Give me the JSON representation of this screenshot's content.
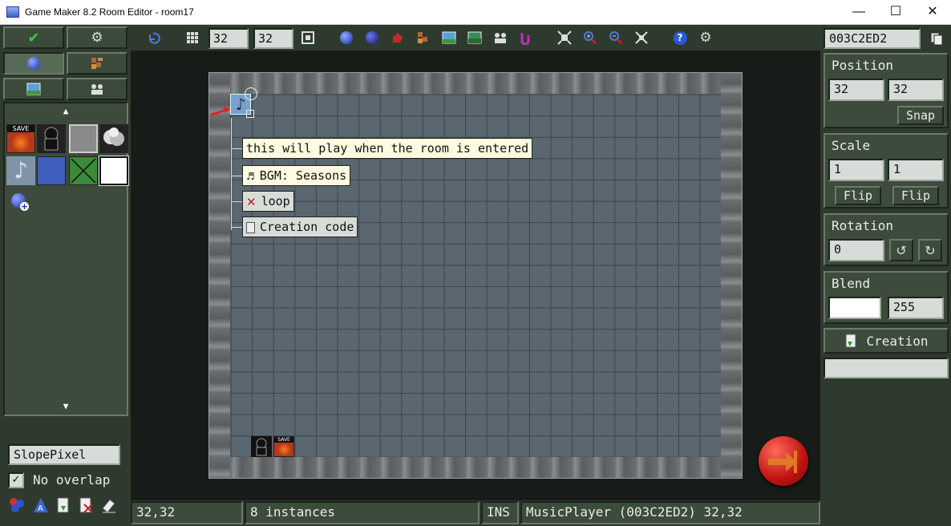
{
  "window": {
    "title": "Game Maker 8.2 Room Editor - room17",
    "controls": [
      "minimize",
      "maximize",
      "close"
    ]
  },
  "toolbar": {
    "grid_x": "32",
    "grid_y": "32"
  },
  "canvas": {
    "tooltips": {
      "description": "this will play when the room is entered",
      "bgm": "BGM: Seasons",
      "loop": "loop",
      "creation_code": "Creation code"
    }
  },
  "right_panel": {
    "instance_id": "003C2ED2",
    "position": {
      "label": "Position",
      "x": "32",
      "y": "32",
      "snap": "Snap"
    },
    "scale": {
      "label": "Scale",
      "x": "1",
      "y": "1",
      "flip": "Flip"
    },
    "rotation": {
      "label": "Rotation",
      "value": "0"
    },
    "blend": {
      "label": "Blend",
      "alpha": "255",
      "color": "#ffffff"
    },
    "creation_button": "Creation"
  },
  "left_panel": {
    "selected_object": "SlopePixel",
    "no_overlap": "No overlap",
    "no_overlap_checked": true,
    "save_label": "SAVE"
  },
  "status": {
    "coords": "32,32",
    "instances": "8 instances",
    "mode": "INS",
    "selection": "MusicPlayer (003C2ED2) 32,32"
  }
}
